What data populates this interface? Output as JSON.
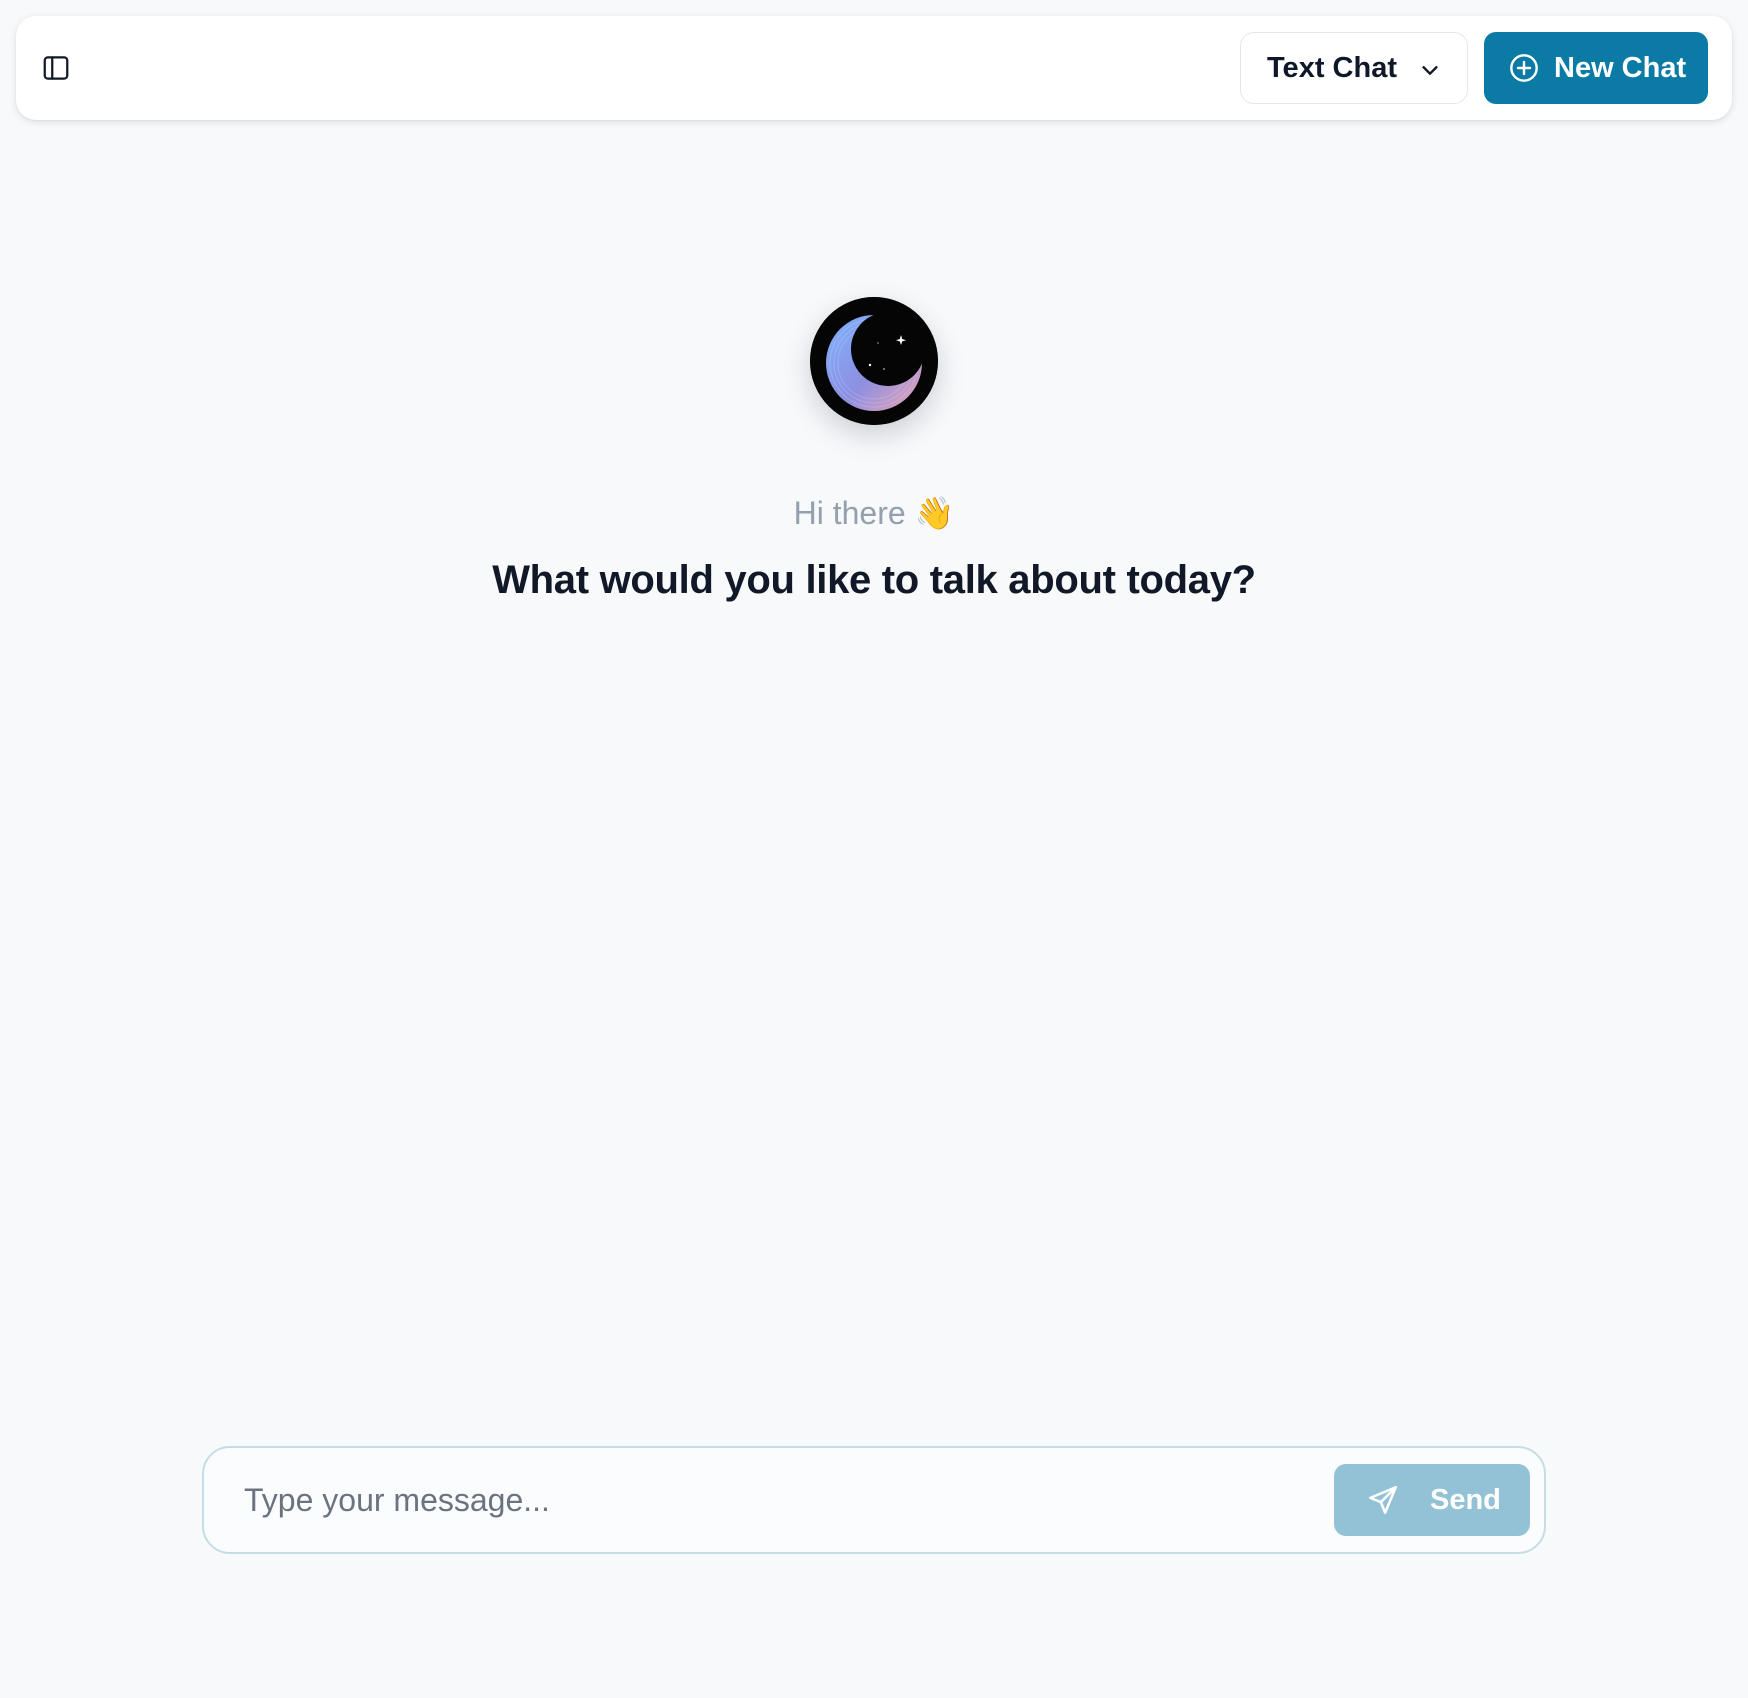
{
  "header": {
    "sidebar_toggle_icon": "sidebar-panel-icon",
    "mode_select": {
      "selected": "Text Chat",
      "icon": "chevron-down-icon"
    },
    "new_chat": {
      "label": "New Chat",
      "icon": "plus-circle-icon"
    }
  },
  "welcome": {
    "avatar_icon": "crescent-moon-logo",
    "greeting": "Hi there 👋",
    "headline": "What would you like to talk about today?"
  },
  "composer": {
    "placeholder": "Type your message...",
    "value": "",
    "send_label": "Send",
    "send_icon": "send-plane-icon"
  },
  "colors": {
    "background": "#f7f9fb",
    "primary": "#0b7ba6",
    "primary_disabled": "#93c2d6",
    "greeting_text": "#94a0ae",
    "headline_text": "#111827"
  }
}
